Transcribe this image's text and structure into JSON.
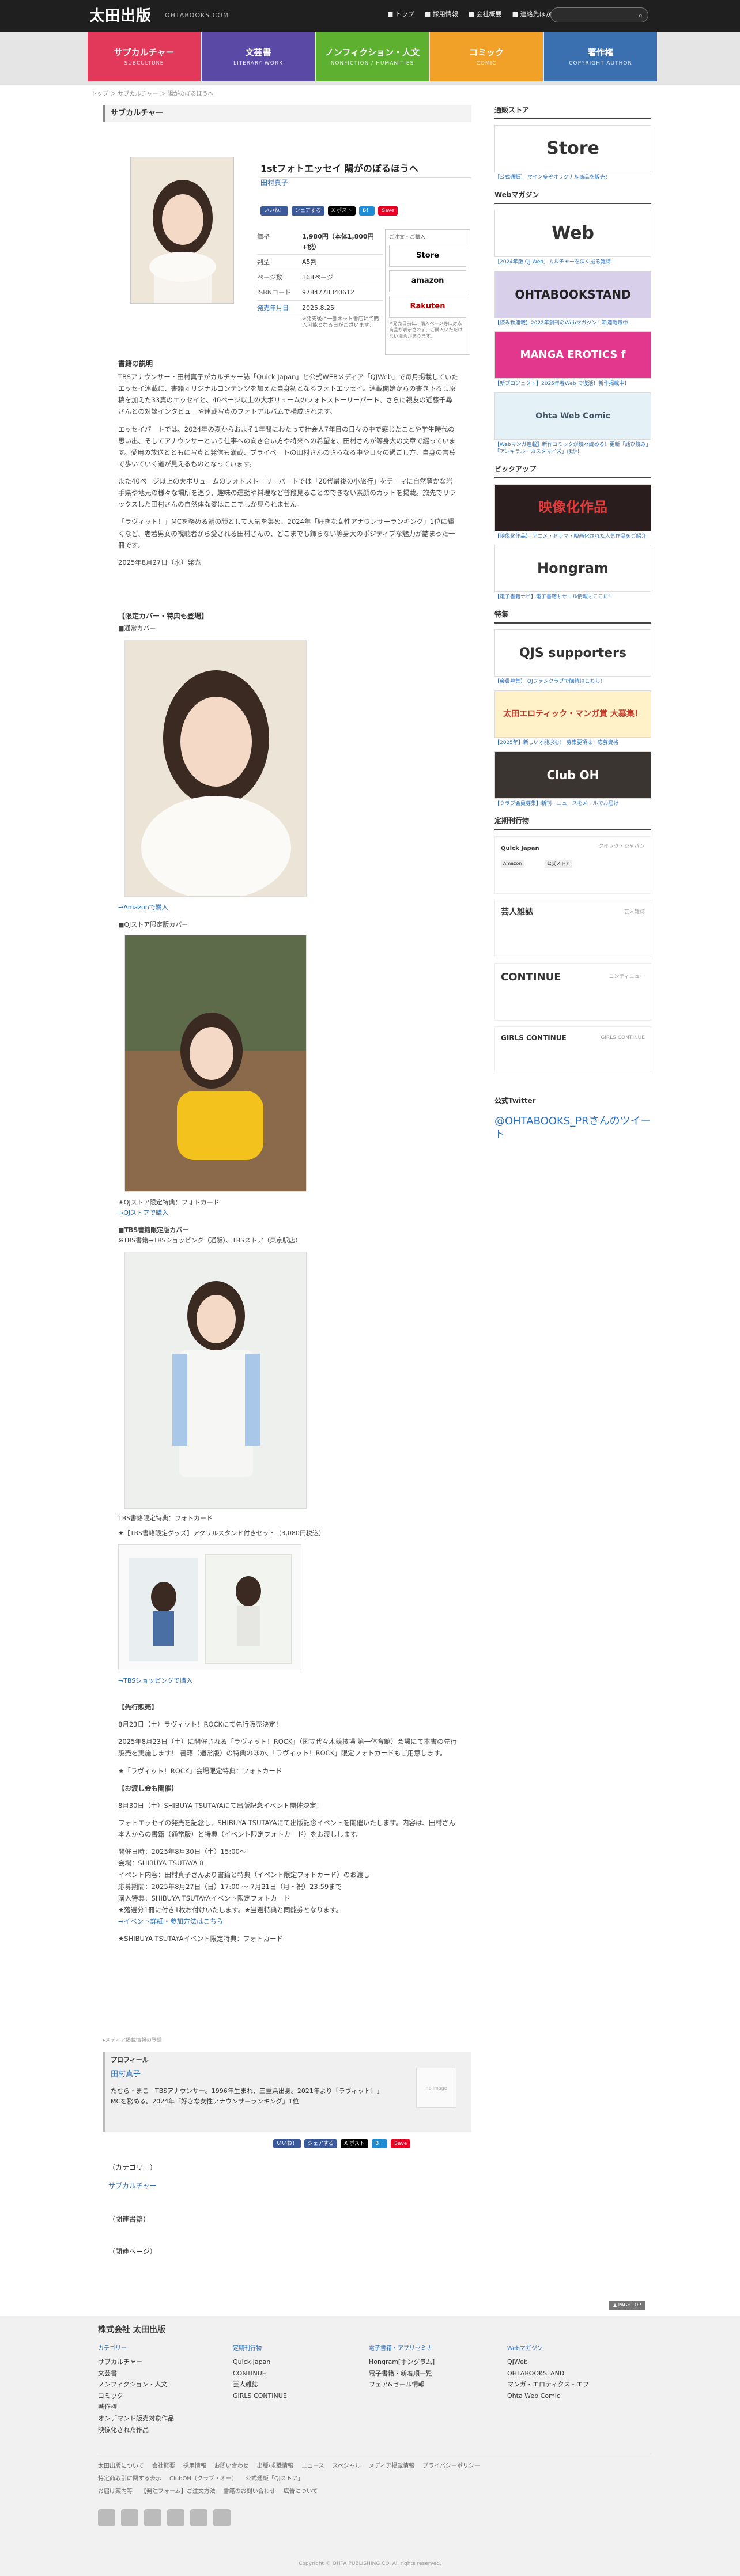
{
  "header": {
    "logo": "太田出版",
    "logo_sub": "OHTABOOKS.COM",
    "nav": [
      "トップ",
      "採用情報",
      "会社概要",
      "連絡先ほか"
    ]
  },
  "global_nav": [
    {
      "label": "サブカルチャー",
      "sub": "SUBCULTURE",
      "color": "#e2395a"
    },
    {
      "label": "文芸書",
      "sub": "LITERARY WORK",
      "color": "#5b4aa5"
    },
    {
      "label": "ノンフィクション・人文",
      "sub": "NONFICTION / HUMANITIES",
      "color": "#5eb030"
    },
    {
      "label": "コミック",
      "sub": "COMIC",
      "color": "#f1a028"
    },
    {
      "label": "著作権",
      "sub": "COPYRIGHT AUTHOR",
      "color": "#3a6fb0"
    }
  ],
  "breadcrumb": "トップ ＞ サブカルチャー ＞ 陽がのぼるほうへ",
  "category_title": "サブカルチャー",
  "product": {
    "title": "1stフォトエッセイ 陽がのぼるほうへ",
    "author": "田村真子",
    "share_buttons": [
      "いいね！",
      "シェアする",
      "X ポスト",
      "B！",
      "Save"
    ],
    "specs": [
      {
        "k": "価格",
        "v": "1,980円（本体1,800円+税）"
      },
      {
        "k": "判型",
        "v": "A5判"
      },
      {
        "k": "ページ数",
        "v": "168ページ"
      },
      {
        "k": "ISBNコード",
        "v": "9784778340612"
      },
      {
        "k": "発売年月日",
        "v": "2025.8.25"
      }
    ],
    "spec_note": "※発売後に一部ネット書店にて購入可能となる日がございます。",
    "buy_header": "ご注文・ご購入",
    "buy_links": [
      "Store",
      "amazon",
      "Rakuten"
    ],
    "buy_note": "※発売日前に、購入ページ等に対応商品が表示されず、ご購入いただけない場合があります。"
  },
  "description": {
    "heading": "書籍の説明",
    "paragraphs": [
      "TBSアナウンサー・田村真子がカルチャー誌「Quick Japan」と公式WEBメディア「QJWeb」で毎月掲載していたエッセイ連載に、書籍オリジナルコンテンツを加えた自身初となるフォトエッセイ。連載開始からの書き下ろし原稿を加えた33篇のエッセイと、40ページ以上の大ボリュームのフォトストーリーパート、さらに親友の近藤千尋さんとの対談インタビューや連載写真のフォトアルバムで構成されます。",
      "エッセイパートでは、2024年の夏からおよそ1年間にわたって社会人7年目の日々の中で感じたことや学生時代の思い出、そしてアナウンサーという仕事への向き合い方や将来への希望を、田村さんが等身大の文章で綴っています。愛用の放送とともに写真と発信も満載、プライベートの田村さんのさらなる中や日々の過ごし方、自身の言葉で歩いていく道が見えるものとなっています。",
      "また40ページ以上の大ボリュームのフォトストーリーパートでは「20代最後の小旅行」をテーマに自然豊かな岩手県や地元の様々な場所を巡り、趣味の運動や料理など普段見ることのできない素顔のカットを掲載。旅先でリラックスした田村さんの自然体な姿はここでしか見られません。",
      "「ラヴィット！」MCを務める朝の顔として人気を集め、2024年「好きな女性アナウンサーランキング」1位に輝くなど、老若男女の視聴者から愛される田村さんの、どこまでも飾らない等身大のポジティブな魅力が詰まった一冊です。"
    ],
    "release": "2025年8月27日（水）発売"
  },
  "editions": {
    "heading": "【限定カバー・特典も登場】",
    "normal_label": "■通常カバー",
    "amazon_link": "→Amazonで購入",
    "qj_label": "■QJストア限定版カバー",
    "qj_caption": "★QJストア限定特典：フォトカード",
    "qj_link": "→QJストアで購入",
    "tbs_label": "■TBS書籍限定版カバー",
    "tbs_sub": "※TBS書籍→TBSショッピング（通販）、TBSストア（東京駅店）",
    "tbs_caption": "TBS書籍限定特典：フォトカード",
    "tbs_goods": "★【TBS書籍限定グッズ】アクリルスタンド付きセット（3,080円税込）",
    "tbs_link": "→TBSショッピングで購入"
  },
  "events": {
    "heading": "【先行販売】",
    "p1": "8月23日（土）ラヴィット！ROCKにて先行販売決定！",
    "p2": "2025年8月23日（土）に開催される「ラヴィット！ROCK」（国立代々木競技場 第一体育館）会場にて本書の先行販売を実施します！ 書籍（通常版）の特典のほか、「ラヴィット！ROCK」限定フォトカードもご用意します。",
    "p3": "★「ラヴィット！ROCK」会場限定特典：フォトカード",
    "heading2": "【お渡し会も開催】",
    "p4": "8月30日（土）SHIBUYA TSUTAYAにて出版記念イベント開催決定！",
    "p5": "フォトエッセイの発売を記念し、SHIBUYA TSUTAYAにて出版記念イベントを開催いたします。内容は、田村さん本人からの書籍（通常版）と特典（イベント限定フォトカード）をお渡しします。",
    "p6": "開催日時：2025年8月30日（土）15:00〜",
    "p7": "会場：SHIBUYA TSUTAYA 8",
    "p8": "イベント内容：田村真子さんより書籍と特典（イベント限定フォトカード）のお渡し",
    "p9": "応募期間：2025年8月27日（日）17:00 〜 7月21日（月・祝）23:59まで",
    "p10": "購入特典：SHIBUYA TSUTAYAイベント限定フォトカード",
    "p11": "★落選分1冊に付き1枚お付けいたします。★当選特典と同能券となります。",
    "link": "→イベント詳細・参加方法はこちら",
    "p12": "★SHIBUYA TSUTAYAイベント限定特典：フォトカード"
  },
  "tags_line": "▸メディア掲載情報の登録",
  "profile": {
    "heading": "プロフィール",
    "name": "田村真子",
    "text": "たむら・まこ　TBSアナウンサー。1996年生まれ、三重県出身。2021年より「ラヴィット！」MCを務める。2024年「好きな女性アナウンサーランキング」1位",
    "noimage": "no image"
  },
  "bottom": {
    "category_label": "（カテゴリー）",
    "category_value": "サブカルチャー",
    "related_books": "（関連書籍）",
    "related_news": "（関連ページ）"
  },
  "sidebar": {
    "store_title": "通販ストア",
    "store_caption": "［公式通販］ マイン多ぞオリジナル商品を販売！",
    "webmag_title": "Webマガジン",
    "qjweb_caption": "［2024年版 QJ Web］カルチャーを深く掘る雑誌",
    "banners": [
      {
        "text": "OHTABOOKSTAND",
        "caption": "【読み物連載】2022年創刊のWebマガジン！新連載毎中"
      },
      {
        "text": "MANGA EROTICS f",
        "caption": "【新プロジェクト】2025年春Web で復活！新作掲載中！"
      },
      {
        "text": "Ohta Web Comic",
        "caption": "【Webマンガ連載】新作コミックが続々読める！更新「話ひ読み」「アンキラル・カスタマイズ」ほか！"
      }
    ],
    "pickup_title": "ピックアップ",
    "pickup": [
      {
        "text": "映像化作品",
        "caption": "【映像化作品】 アニメ・ドラマ・映画化された人気作品をご紹介"
      },
      {
        "text": "Hongram",
        "caption": "【電子書籍ナビ】電子書籍もセール情報もここに！"
      }
    ],
    "feature_title": "特集",
    "features": [
      {
        "text": "QJS supporters",
        "caption": "【会員募集】 QJファンクラブで購読はこちら！"
      },
      {
        "text": "太田エロティック・マンガ賞 大募集！",
        "caption": "【2025年】新しい才能求む！ 募集要項は・応募資格"
      },
      {
        "text": "Club OH",
        "caption": "【クラブ会員募集】新刊・ニュースをメールでお届け"
      }
    ],
    "magazines_title": "定期刊行物",
    "magazines": [
      {
        "name": "Quick Japan",
        "ja": "クイック・ジャパン"
      },
      {
        "name": "芸人雑誌",
        "ja": "芸人雑誌"
      },
      {
        "name": "CONTINUE",
        "ja": "コンティニュー"
      },
      {
        "name": "GIRLS CONTINUE",
        "ja": "GIRLS CONTINUE"
      }
    ],
    "amazon_btn": "Amazon",
    "kindle_btn": "公式ストア",
    "twitter_title": "公式Twitter",
    "twitter_link": "@OHTABOOKS_PRさんのツイート"
  },
  "pagetop": "▲ PAGE TOP",
  "footer": {
    "company": "株式会社 太田出版",
    "columns": [
      {
        "head": "カテゴリー",
        "items": [
          "サブカルチャー",
          "文芸書",
          "ノンフィクション・人文",
          "コミック",
          "著作権",
          "オンデマンド販売対象作品",
          "映像化された作品"
        ]
      },
      {
        "head": "定期刊行物",
        "items": [
          "Quick Japan",
          "CONTINUE",
          "芸人雑誌",
          "GIRLS CONTINUE"
        ]
      },
      {
        "head": "電子書籍・アプリセミナ",
        "items": [
          "Hongram[ホングラム]",
          "電子書籍・新着順一覧",
          "フェア&セール情報"
        ]
      },
      {
        "head": "Webマガジン",
        "items": [
          "QJWeb",
          "OHTABOOKSTAND",
          "マンガ・エロティクス・エフ",
          "Ohta Web Comic"
        ]
      }
    ],
    "links_row1": [
      "太田出版について",
      "会社概要",
      "採用情報",
      "お問い合わせ",
      "出版/求職情報",
      "ニュース",
      "スペシャル",
      "メディア掲載情報",
      "プライバシーポリシー"
    ],
    "links_row2": [
      "特定商取引に関する表示",
      "ClubOH（クラブ・オー）",
      "公式通販「QJストア」"
    ],
    "links_row3": [
      "お届け案内等",
      "【発注フォーム】ご注文方法",
      "書籍のお問い合わせ",
      "広告について"
    ],
    "copyright": "Copyright © OHTA PUBLISHING CO. All rights reserved."
  }
}
